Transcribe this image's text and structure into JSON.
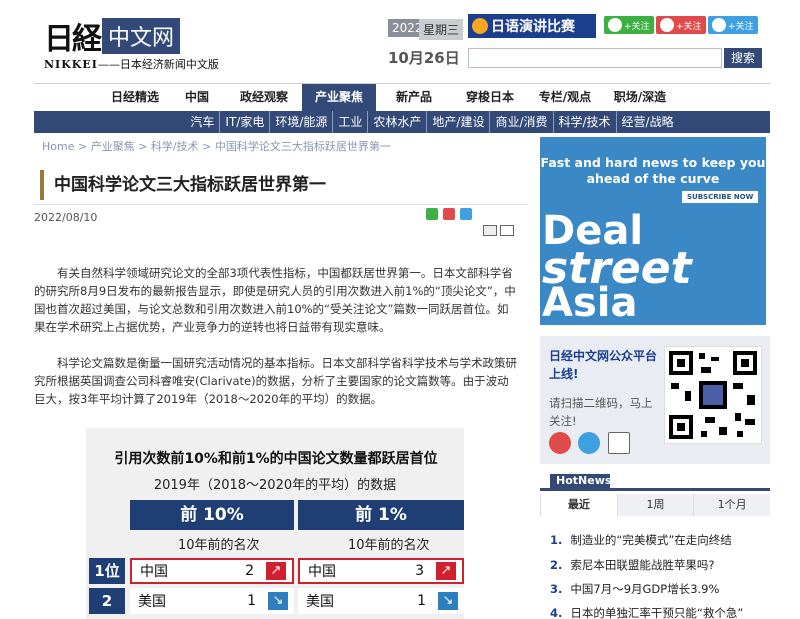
{
  "header": {
    "logo_jp": "日経",
    "logo_cn": "中文网",
    "logo_sub_en": "NIKKEI",
    "logo_sub_cn": "——日本经济新闻中文版",
    "year": "2022",
    "weekday": "星期三",
    "date": "10月26日",
    "banner": "日语演讲比赛",
    "follow": [
      "+关注",
      "+关注",
      "+关注"
    ],
    "search_btn": "搜索"
  },
  "nav": [
    "日经精选",
    "中国",
    "政经观察",
    "产业聚焦",
    "新产品",
    "穿梭日本",
    "专栏/观点",
    "职场/深造"
  ],
  "nav_active": "产业聚焦",
  "subnav": [
    "汽车",
    "IT/家电",
    "环境/能源",
    "工业",
    "农林水产",
    "地产/建设",
    "商业/消费",
    "科学/技术",
    "经营/战略"
  ],
  "breadcrumb": "Home > 产业聚焦 > 科学/技术 > 中国科学论文三大指标跃居世界第一",
  "article": {
    "title": "中国科学论文三大指标跃居世界第一",
    "date": "2022/08/10",
    "para1": "有关自然科学领域研究论文的全部3项代表性指标，中国都跃居世界第一。日本文部科学省的研究所8月9日发布的最新报告显示，即使是研究人员的引用次数进入前1%的“顶尖论文”，中国也首次超过美国，与论文总数和引用次数进入前10%的“受关注论文”篇数一同跃居首位。如果在学术研究上占据优势，产业竞争力的逆转也将日益带有现实意味。",
    "para2": "科学论文篇数是衡量一国研究活动情况的基本指标。日本文部科学省科学技术与学术政策研究所根据英国调查公司科睿唯安(Clarivate)的数据，分析了主要国家的论文篇数等。由于波动巨大，按3年平均计算了2019年（2018～2020年的平均）的数据。"
  },
  "figure": {
    "title": "引用次数前10%和前1%的中国论文数量都跃居首位",
    "subtitle": "2019年（2018～2020年的平均）的数据",
    "col1": "前 10%",
    "col2": "前 1%",
    "col_sub": "10年前的名次",
    "ranks": [
      "1位",
      "2"
    ],
    "left": [
      {
        "country": "中国",
        "prev": "2",
        "dir": "up"
      },
      {
        "country": "美国",
        "prev": "1",
        "dir": "down"
      }
    ],
    "right": [
      {
        "country": "中国",
        "prev": "3",
        "dir": "up"
      },
      {
        "country": "美国",
        "prev": "1",
        "dir": "down"
      }
    ]
  },
  "ad": {
    "top": "Fast and hard news to keep you ahead of the curve",
    "btn": "SUBSCRIBE NOW",
    "w1": "Deal",
    "w2": "street",
    "w3": "Asia"
  },
  "wechat": {
    "title": "日经中文网公众平台上线!",
    "desc": "请扫描二维码，马上关注!"
  },
  "hotnews": {
    "label": "HotNews",
    "tabs": [
      "最近",
      "1周",
      "1个月"
    ],
    "items": [
      {
        "n": "1.",
        "t": "制造业的“完美模式”在走向终结"
      },
      {
        "n": "2.",
        "t": "索尼本田联盟能战胜苹果吗?"
      },
      {
        "n": "3.",
        "t": "中国7月～9月GDP增长3.9%"
      },
      {
        "n": "4.",
        "t": "日本的单独汇率干预只能“救个急”"
      }
    ]
  },
  "colors": {
    "navy": "#334a78",
    "accent_red": "#d0202e",
    "ad_blue": "#3a88c6"
  }
}
